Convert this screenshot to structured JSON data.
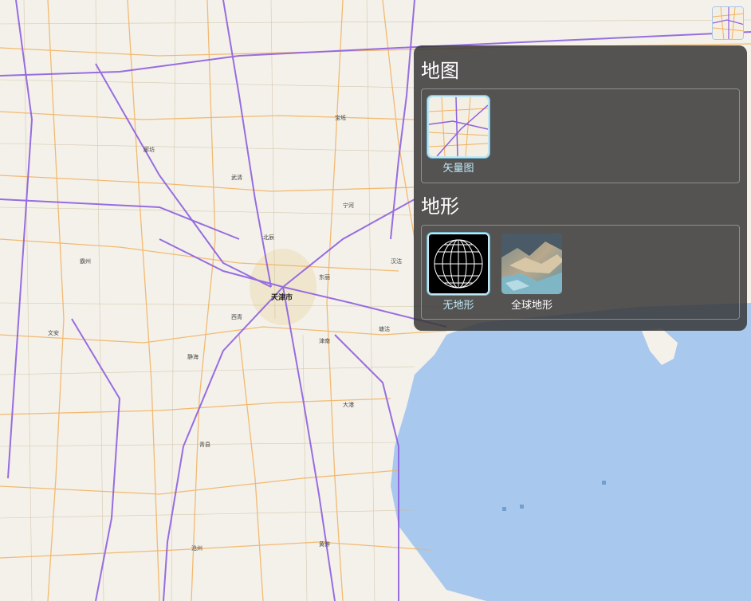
{
  "map": {
    "labels": [
      "天津市",
      "塘沽",
      "大港",
      "静海",
      "武清",
      "廊坊",
      "霸州",
      "文安",
      "青县",
      "沧州",
      "黄骅",
      "宁河",
      "汉沽",
      "北辰",
      "西青",
      "津南",
      "东丽",
      "宝坻"
    ]
  },
  "layer_panel": {
    "map_section": {
      "title": "地图",
      "items": [
        {
          "label": "矢量图",
          "icon": "vector-map-thumbnail",
          "selected": true
        }
      ]
    },
    "terrain_section": {
      "title": "地形",
      "items": [
        {
          "label": "无地形",
          "icon": "wireframe-globe-icon",
          "selected": true
        },
        {
          "label": "全球地形",
          "icon": "terrain-thumbnail",
          "selected": false
        }
      ]
    }
  },
  "colors": {
    "land": "#f4f1ea",
    "sea": "#a9c8ee",
    "highway": "#8d5fe0",
    "road": "#f2b15c",
    "panel": "#373737",
    "selected_border": "#bfe8f4"
  }
}
